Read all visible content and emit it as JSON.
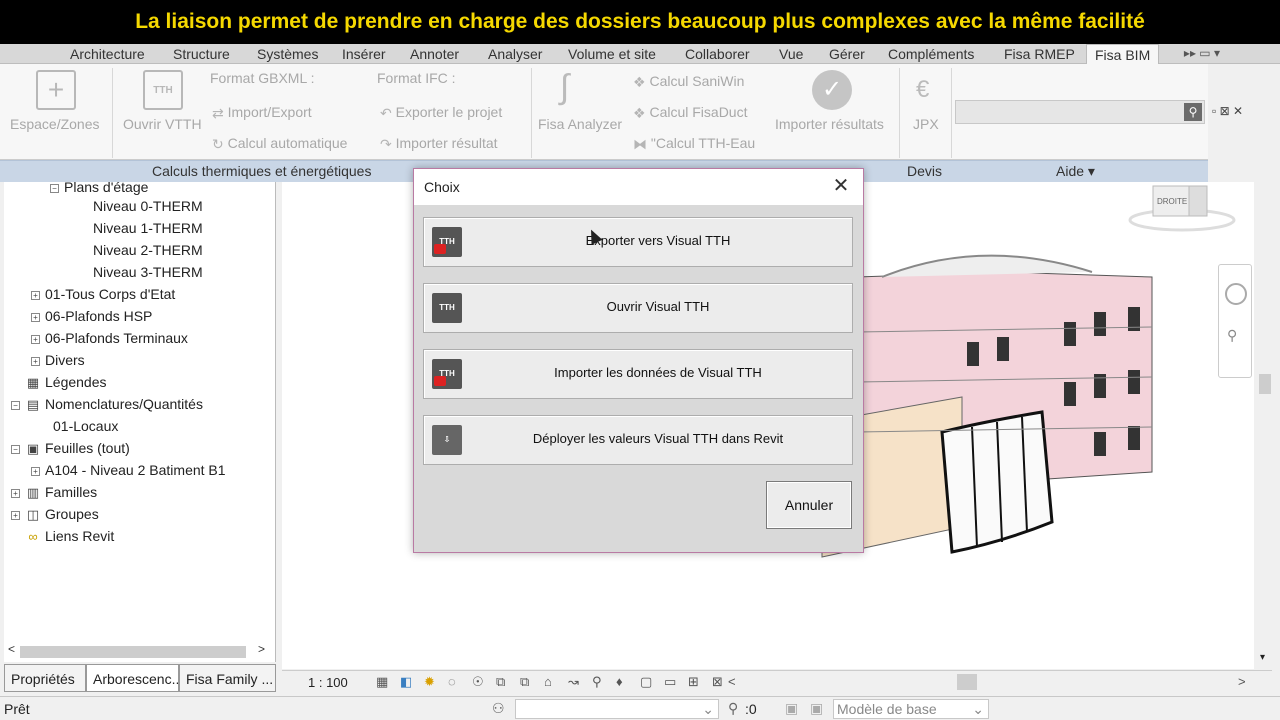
{
  "banner": {
    "text": "La liaison permet de prendre en charge des dossiers beaucoup plus complexes avec la même facilité"
  },
  "ribbon_tabs": [
    "Architecture",
    "Structure",
    "Systèmes",
    "Insérer",
    "Annoter",
    "Analyser",
    "Volume et site",
    "Collaborer",
    "Vue",
    "Gérer",
    "Compléments",
    "Fisa RMEP",
    "Fisa BIM"
  ],
  "ribbon": {
    "espace_zones": "Espace/Zones",
    "ouvrir_vtth": "Ouvrir VTTH",
    "format_gbxml": "Format GBXML :",
    "import_export": "Import/Export",
    "calcul_auto": "Calcul automatique",
    "format_ifc": "Format IFC :",
    "exporter_projet": "Exporter le projet",
    "importer_resultat": "Importer résultat",
    "fisa_analyzer": "Fisa Analyzer",
    "calcul_saniwin": "Calcul SaniWin",
    "calcul_fisaduct": "Calcul FisaDuct",
    "calcul_tth_eau": "\"Calcul TTH-Eau",
    "importer_resultats": "Importer résultats",
    "jpx": "JPX",
    "group_thermique": "Calculs thermiques et énergétiques",
    "group_devis": "Devis",
    "group_aide": "Aide"
  },
  "browser": {
    "items": [
      {
        "label": "Plans d'étage",
        "indent": 1,
        "pm": "⊟"
      },
      {
        "label": "Niveau 0-THERM",
        "indent": 2
      },
      {
        "label": "Niveau 1-THERM",
        "indent": 2
      },
      {
        "label": "Niveau 2-THERM",
        "indent": 2
      },
      {
        "label": "Niveau 3-THERM",
        "indent": 2
      },
      {
        "label": "01-Tous Corps d'Etat",
        "indent": 1,
        "pm": "+"
      },
      {
        "label": "06-Plafonds HSP",
        "indent": 1,
        "pm": "+"
      },
      {
        "label": "06-Plafonds Terminaux",
        "indent": 1,
        "pm": "+"
      },
      {
        "label": "Divers",
        "indent": 1,
        "pm": "+"
      },
      {
        "label": "Légendes",
        "indent": 0,
        "icon": "▦"
      },
      {
        "label": "Nomenclatures/Quantités",
        "indent": 0,
        "pm": "−",
        "icon": "▤"
      },
      {
        "label": "01-Locaux",
        "indent": 1
      },
      {
        "label": "Feuilles (tout)",
        "indent": 0,
        "pm": "−",
        "icon": "▣"
      },
      {
        "label": "A104 - Niveau 2 Batiment B1",
        "indent": 1,
        "pm": "+"
      },
      {
        "label": "Familles",
        "indent": 0,
        "pm": "+",
        "icon": "▥"
      },
      {
        "label": "Groupes",
        "indent": 0,
        "pm": "+",
        "icon": "◫"
      },
      {
        "label": "Liens Revit",
        "indent": 0,
        "icon": "∞"
      }
    ],
    "tabs": [
      "Propriétés",
      "Arborescenc...",
      "Fisa Family ..."
    ]
  },
  "dialog": {
    "title": "Choix",
    "buttons": [
      "Exporter vers Visual TTH",
      "Ouvrir Visual TTH",
      "Importer les données de Visual TTH",
      "Déployer les valeurs Visual TTH dans Revit"
    ],
    "cancel": "Annuler"
  },
  "viewbar": {
    "scale": "1 : 100"
  },
  "statusbar": {
    "status": "Prêt",
    "count": ":0",
    "model": "Modèle de base"
  },
  "colors": {
    "banner_text": "#f5d800",
    "group_bar": "#c9d6e6",
    "dialog_border": "#b97aa3"
  }
}
